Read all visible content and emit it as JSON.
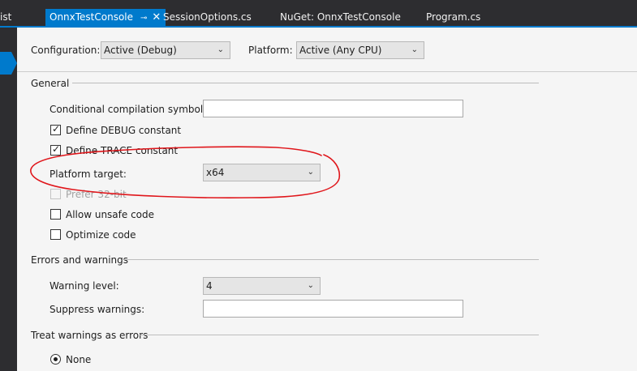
{
  "tabs": {
    "partial": "ist",
    "active": "OnnxTestConsole",
    "pin_glyph": "⊸",
    "close_glyph": "✕",
    "tab2": "SessionOptions.cs",
    "tab3": "NuGet: OnnxTestConsole",
    "tab4": "Program.cs"
  },
  "header": {
    "configuration_label": "Configuration:",
    "configuration_value": "Active (Debug)",
    "platform_label": "Platform:",
    "platform_value": "Active (Any CPU)"
  },
  "general": {
    "heading": "General",
    "symbols_label": "Conditional compilation symbols:",
    "symbols_value": "",
    "define_debug": "Define DEBUG constant",
    "define_trace": "Define TRACE constant",
    "platform_target_label": "Platform target:",
    "platform_target_value": "x64",
    "prefer32": "Prefer 32-bit",
    "unsafe": "Allow unsafe code",
    "optimize": "Optimize code"
  },
  "errors": {
    "heading": "Errors and warnings",
    "warning_level_label": "Warning level:",
    "warning_level_value": "4",
    "suppress_label": "Suppress warnings:",
    "suppress_value": ""
  },
  "treat": {
    "heading": "Treat warnings as errors",
    "none_label": "None"
  },
  "state": {
    "define_debug_checked": true,
    "define_trace_checked": true,
    "prefer32_checked": false,
    "prefer32_enabled": false,
    "unsafe_checked": false,
    "optimize_checked": false,
    "treat_none_selected": true
  },
  "colors": {
    "accent": "#007acc",
    "annotation": "#e0161b",
    "tab_bar": "#2d2d30",
    "panel": "#f5f5f5"
  },
  "icons": {
    "dropdown": "chevron-down-icon",
    "checkbox": "checkmark-icon",
    "pin": "pin-icon",
    "close": "close-icon"
  }
}
